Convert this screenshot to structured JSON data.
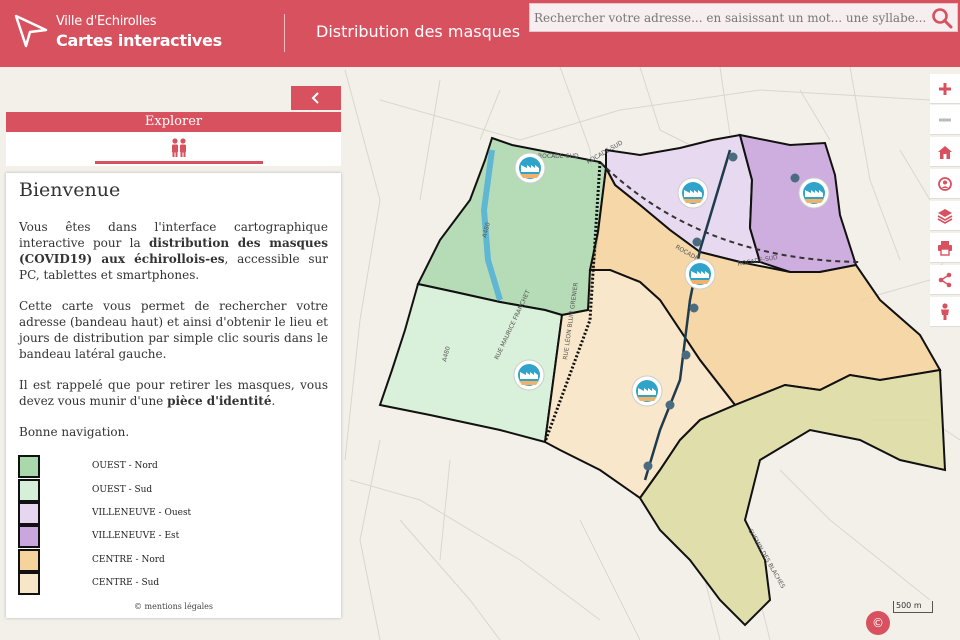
{
  "header": {
    "brand_top": "Ville d'Echirolles",
    "brand_bottom": "Cartes interactives",
    "title": "Distribution des masques",
    "search_placeholder": "Rechercher votre adresse... en saisissant un mot... une syllabe..."
  },
  "sidebar": {
    "tab_label": "Explorer",
    "heading": "Bienvenue",
    "p1_a": "Vous êtes dans l'interface cartographique interactive pour la ",
    "p1_bold": "distribution des masques (COVID19) aux échirollois-es",
    "p1_b": ", accessible sur PC, tablettes et smartphones.",
    "p2": "Cette carte vous permet de rechercher votre adresse (bandeau haut) et ainsi d'obtenir le lieu et jours de distribution par simple clic souris dans le bandeau latéral gauche.",
    "p3_a": "Il est rappelé que pour retirer les masques, vous devez vous munir d'une ",
    "p3_bold": "pièce d'identité",
    "p3_b": ".",
    "p4": "Bonne navigation.",
    "legend": [
      {
        "label": "OUEST - Nord",
        "color": "#a9d8ad"
      },
      {
        "label": "OUEST - Sud",
        "color": "#d6efd8"
      },
      {
        "label": "VILLENEUVE - Ouest",
        "color": "#e6d6f0"
      },
      {
        "label": "VILLENEUVE - Est",
        "color": "#c9a6dd"
      },
      {
        "label": "CENTRE - Nord",
        "color": "#f6d29c"
      },
      {
        "label": "CENTRE - Sud",
        "color": "#f8e6c8"
      }
    ],
    "mentions": "© mentions légales"
  },
  "map": {
    "street_labels": [
      "ROCADE-SUD",
      "ROCADE-SUD",
      "ROCADE-SUD",
      "ROCADE-SUD",
      "A480",
      "A480",
      "RUE LÉON BLUM GRENIER",
      "RUE MAURICE FRANCHET",
      "CHEMIN DES BLACHES"
    ],
    "scale": "500 m",
    "copyright": "©"
  },
  "toolbar": {
    "icons": [
      "plus-icon",
      "minus-icon",
      "home-icon",
      "locate-icon",
      "layers-icon",
      "print-icon",
      "share-icon",
      "person-icon"
    ]
  },
  "colors": {
    "accent": "#d8515f"
  }
}
